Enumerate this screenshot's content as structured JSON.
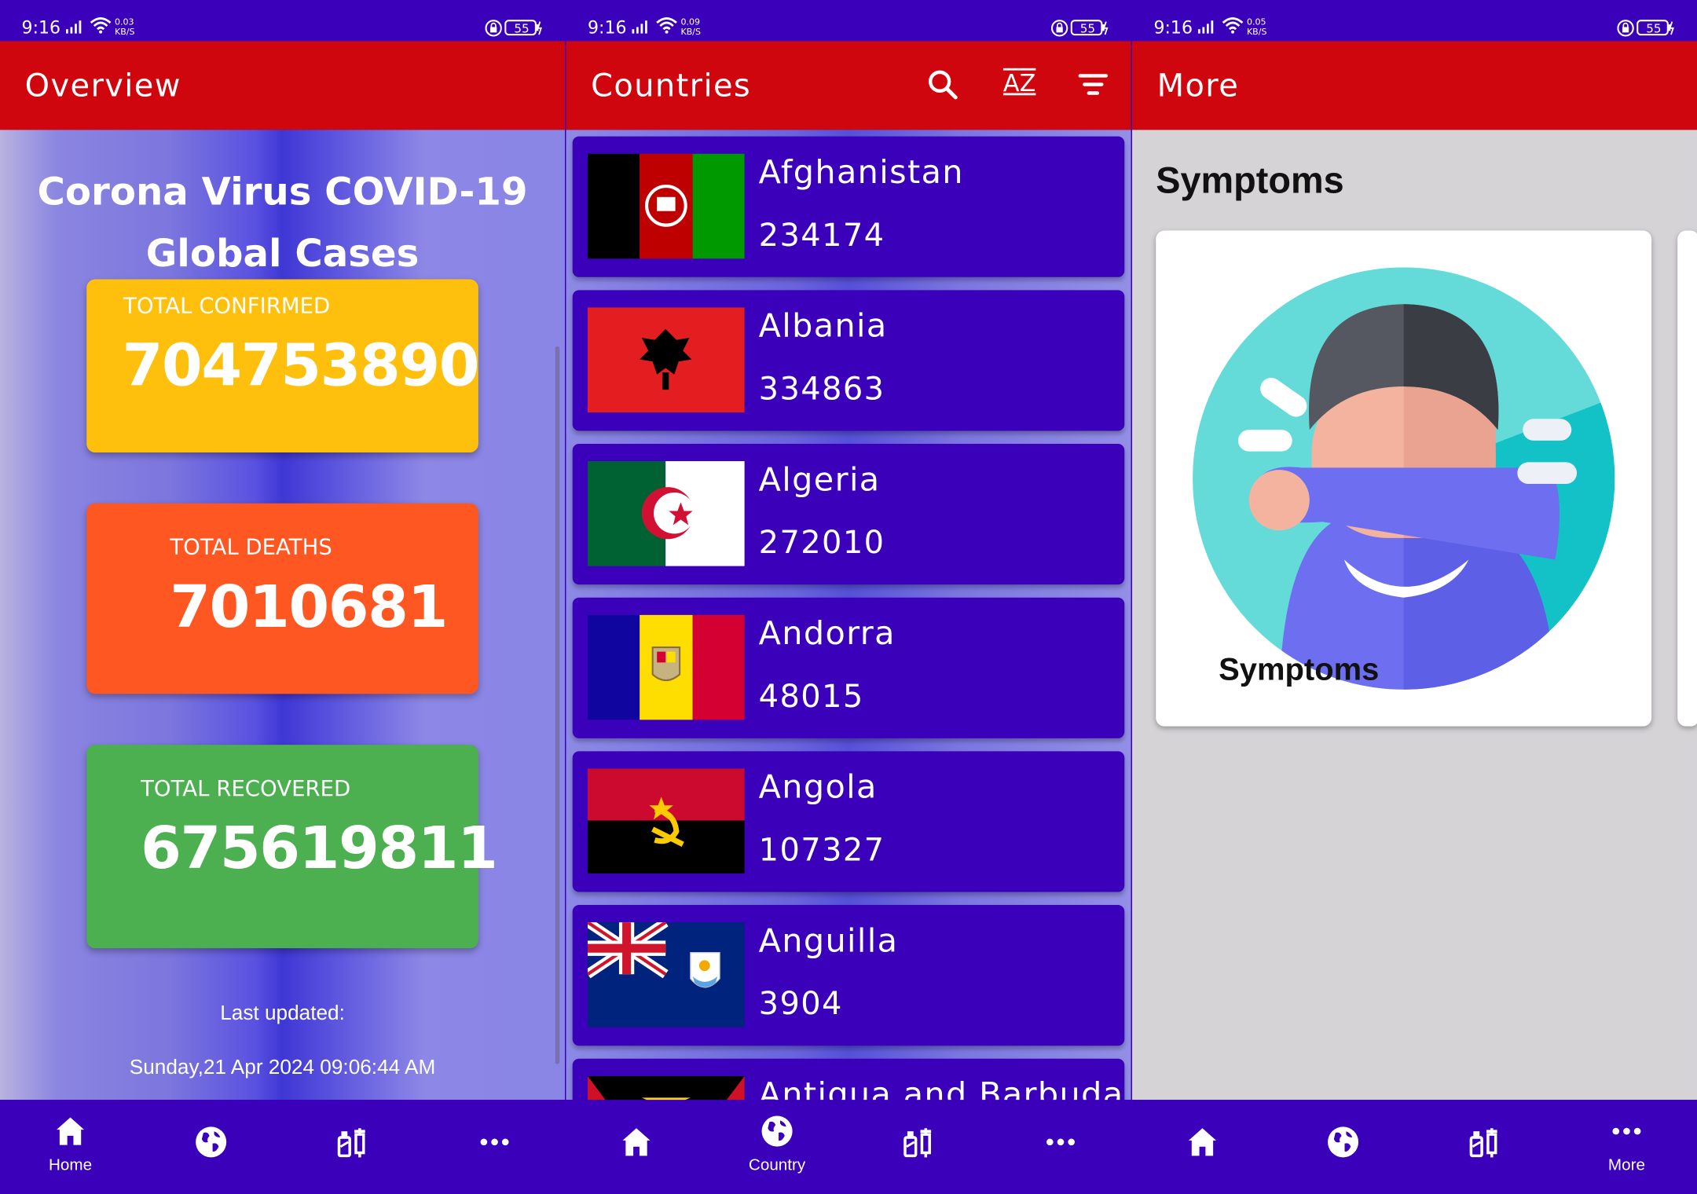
{
  "status_bar": {
    "time": "9:16",
    "speeds": [
      "0.03",
      "0.09",
      "0.05"
    ],
    "speed_unit": "KB/S",
    "battery": "55"
  },
  "overview": {
    "appbar_title": "Overview",
    "title_line1": "Corona Virus COVID-19",
    "title_line2": "Global Cases",
    "confirmed_label": "TOTAL CONFIRMED",
    "confirmed_value": "704753890",
    "deaths_label": "TOTAL DEATHS",
    "deaths_value": "7010681",
    "recovered_label": "TOTAL RECOVERED",
    "recovered_value": "675619811",
    "last_updated_label": "Last updated:",
    "last_updated_value": "Sunday,21 Apr 2024 09:06:44 AM"
  },
  "countries": {
    "appbar_title": "Countries",
    "sort_label": "AZ",
    "items": [
      {
        "name": "Afghanistan",
        "cases": "234174"
      },
      {
        "name": "Albania",
        "cases": "334863"
      },
      {
        "name": "Algeria",
        "cases": "272010"
      },
      {
        "name": "Andorra",
        "cases": "48015"
      },
      {
        "name": "Angola",
        "cases": "107327"
      },
      {
        "name": "Anguilla",
        "cases": "3904"
      },
      {
        "name": "Antigua and Barbuda",
        "cases": ""
      }
    ]
  },
  "more": {
    "appbar_title": "More",
    "heading": "Symptoms",
    "card_label": "Symptoms"
  },
  "nav": {
    "home": "Home",
    "country": "Country",
    "more": "More"
  },
  "colors": {
    "primary": "#3b00b9",
    "appbar": "#d0060e",
    "confirmed": "#ffbf0d",
    "deaths": "#fe5722",
    "recovered": "#4caf50"
  }
}
